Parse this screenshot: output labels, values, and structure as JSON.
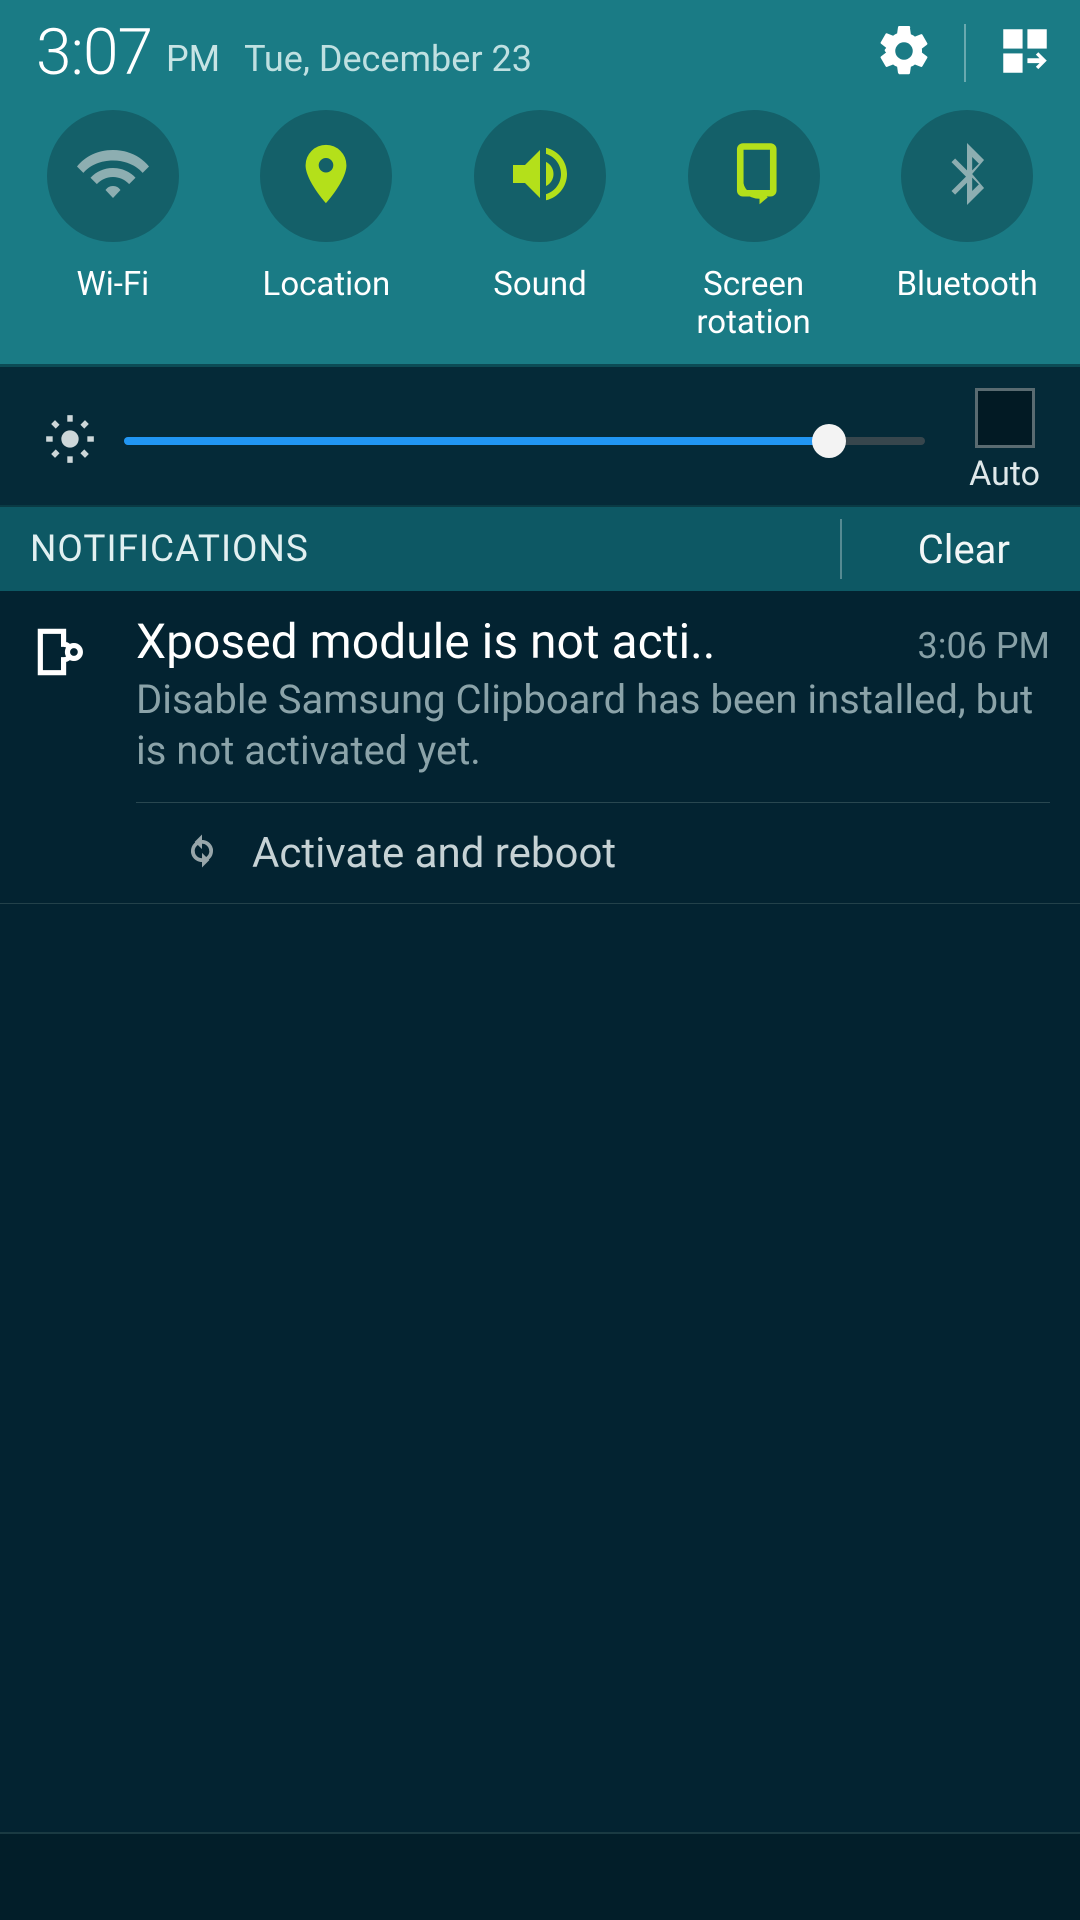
{
  "header": {
    "time": "3:07",
    "ampm": "PM",
    "date": "Tue, December 23"
  },
  "toggles": [
    {
      "label": "Wi-Fi",
      "active": false,
      "icon": "wifi-icon"
    },
    {
      "label": "Location",
      "active": true,
      "icon": "location-icon"
    },
    {
      "label": "Sound",
      "active": true,
      "icon": "sound-icon"
    },
    {
      "label": "Screen rotation",
      "active": true,
      "icon": "rotation-icon"
    },
    {
      "label": "Bluetooth",
      "active": false,
      "icon": "bluetooth-icon"
    }
  ],
  "brightness": {
    "percent": 88,
    "auto_label": "Auto",
    "auto_checked": false
  },
  "notif_bar": {
    "title": "NOTIFICATIONS",
    "clear": "Clear"
  },
  "notification": {
    "title": "Xposed module is not acti..",
    "time": "3:06 PM",
    "body": "Disable Samsung Clipboard has been installed, but is not activated yet.",
    "action": "Activate and reboot"
  }
}
